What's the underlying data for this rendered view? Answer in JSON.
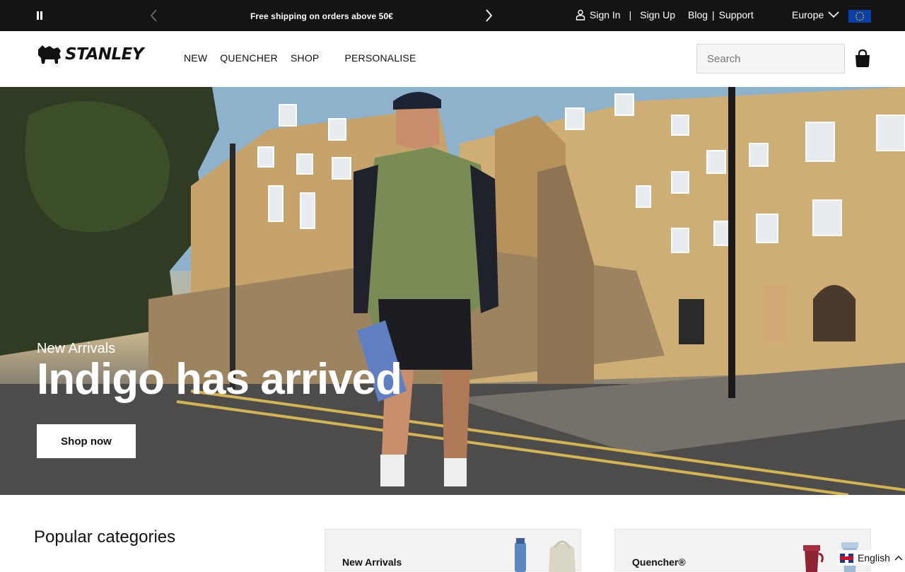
{
  "announcement": {
    "message": "Free shipping on orders above 50€"
  },
  "account": {
    "sign_in": "Sign In",
    "sign_up": "Sign Up",
    "separator": "|"
  },
  "utility_links": {
    "blog": "Blog",
    "support": "Support",
    "separator": "|"
  },
  "region": {
    "label": "Europe"
  },
  "brand": {
    "name": "STANLEY"
  },
  "nav": {
    "items": [
      "NEW",
      "QUENCHER",
      "SHOP",
      "PERSONALISE"
    ]
  },
  "search": {
    "placeholder": "Search"
  },
  "hero": {
    "overline": "New Arrivals",
    "headline": "Indigo has arrived",
    "cta": "Shop now"
  },
  "categories": {
    "title": "Popular categories",
    "cards": [
      {
        "label": "New Arrivals"
      },
      {
        "label": "Quencher®"
      }
    ]
  },
  "language": {
    "label": "English"
  },
  "colors": {
    "topbar": "#141414",
    "accent": "#ffffff",
    "eu_flag": "#0a3ea8"
  }
}
